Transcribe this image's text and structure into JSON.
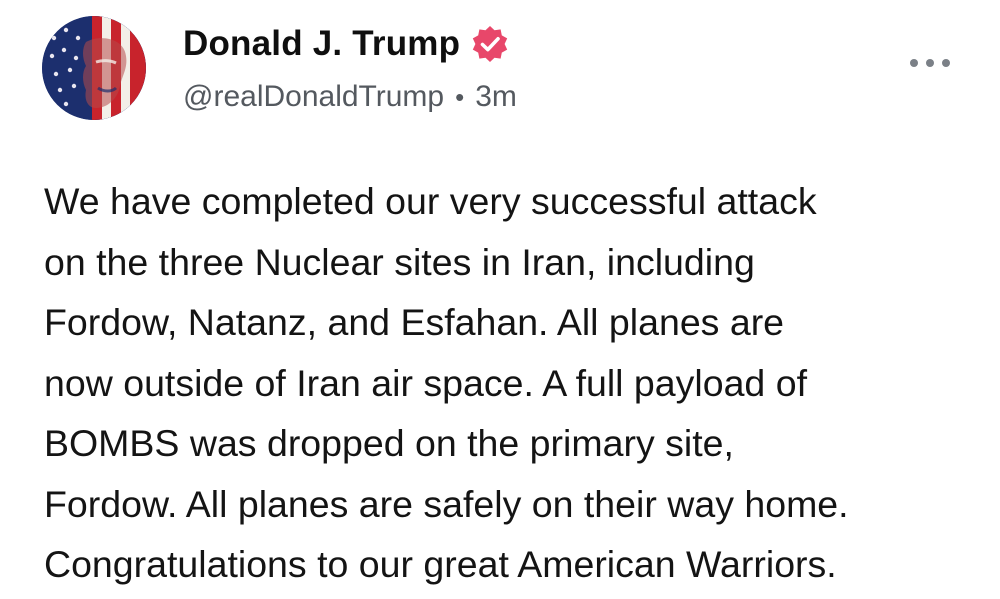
{
  "author": {
    "display_name": "Donald J. Trump",
    "handle": "@realDonaldTrump",
    "timestamp": "3m",
    "separator": "•",
    "avatar_icon": "flag-portrait-avatar-icon",
    "verified_icon": "verified-badge-icon"
  },
  "menu": {
    "icon": "more-options-icon"
  },
  "post": {
    "lines": [
      "We have completed our very successful attack",
      "on the three Nuclear sites in Iran, including",
      "Fordow, Natanz, and Esfahan. All planes are",
      "now outside of Iran air space. A full payload of",
      "BOMBS was dropped on the primary site,",
      "Fordow. All planes are safely on their way home.",
      "Congratulations to our great American Warriors."
    ]
  },
  "colors": {
    "verified_badge": "#e8476a",
    "handle_text": "#54595f",
    "body_text": "#141414",
    "avatar_blue": "#1c2f6e",
    "avatar_red": "#c8232c"
  }
}
